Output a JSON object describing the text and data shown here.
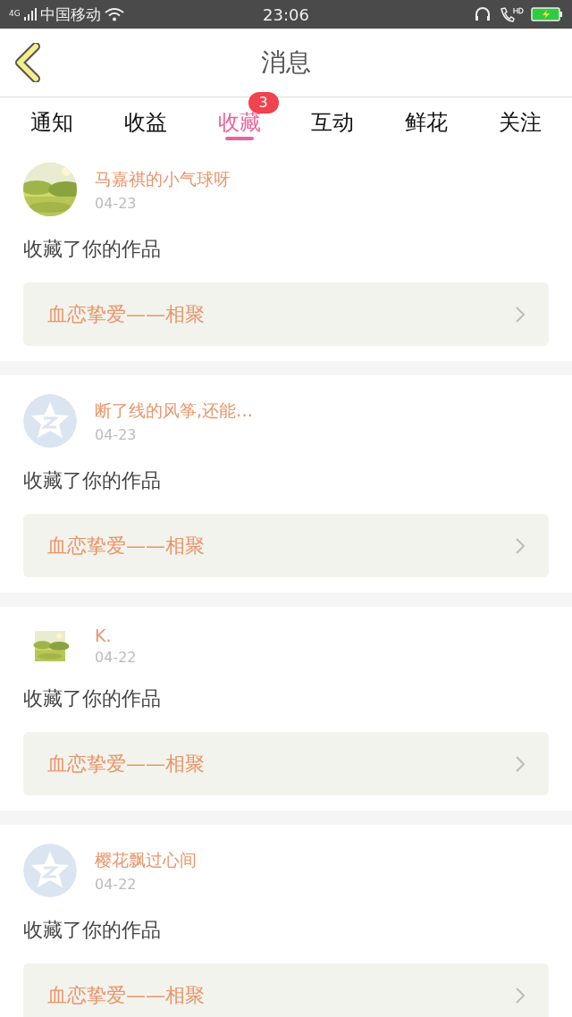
{
  "status_bar": {
    "network": "4G",
    "carrier": "中国移动",
    "time": "23:06"
  },
  "header": {
    "title": "消息"
  },
  "tabs": [
    {
      "label": "通知",
      "selected": false
    },
    {
      "label": "收益",
      "selected": false
    },
    {
      "label": "收藏",
      "selected": true,
      "badge": "3"
    },
    {
      "label": "互动",
      "selected": false
    },
    {
      "label": "鲜花",
      "selected": false
    },
    {
      "label": "关注",
      "selected": false
    }
  ],
  "messages": [
    {
      "name": "马嘉祺的小气球呀",
      "date": "04-23",
      "action": "收藏了你的作品",
      "work": "血恋挚爱——相聚"
    },
    {
      "avatar": {
        "kind": "default"
      },
      "name": "断了线的风筝,还能…",
      "date": "04-23",
      "action": "收藏了你的作品",
      "work": "血恋挚爱——相聚"
    },
    {
      "name": "K.",
      "date": "04-22",
      "action": "收藏了你的作品",
      "work": "血恋挚爱——相聚"
    },
    {
      "avatar": {
        "kind": "default"
      },
      "name": "樱花飘过心间",
      "date": "04-22",
      "action": "收藏了你的作品",
      "work": "血恋挚爱——相聚"
    }
  ]
}
